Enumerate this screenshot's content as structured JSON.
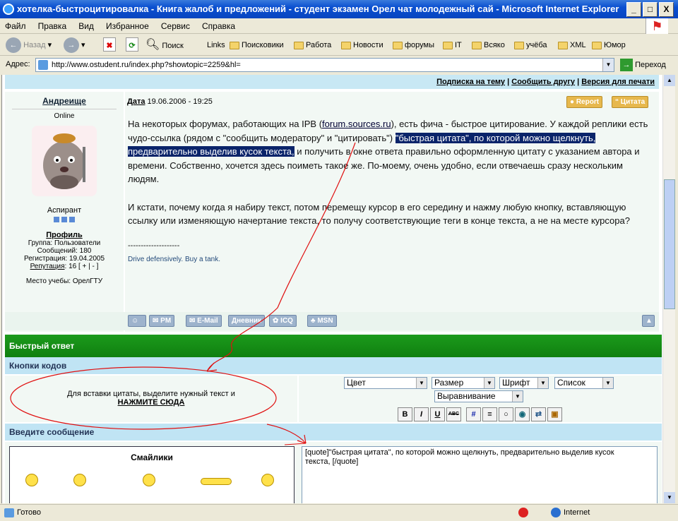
{
  "window": {
    "title": "хотелка-быстроцитировалка - Книга жалоб и предложений - студент экзамен Орел чат молодежный сай - Microsoft Internet Explorer",
    "minimize": "_",
    "maximize": "□",
    "close": "X"
  },
  "menu": [
    "Файл",
    "Правка",
    "Вид",
    "Избранное",
    "Сервис",
    "Справка"
  ],
  "toolbar": {
    "back": "Назад",
    "search": "Поиск",
    "links_label": "Links",
    "links": [
      "Поисковики",
      "Работа",
      "Новости",
      "форумы",
      "IT",
      "Всяко",
      "учёба",
      "XML",
      "Юмор"
    ]
  },
  "address": {
    "label": "Адрес:",
    "url": "http://www.ostudent.ru/index.php?showtopic=2259&hl=",
    "go": "Переход"
  },
  "topic_links": {
    "subscribe": "Подписка на тему",
    "send": "Сообщить другу",
    "print": "Версия для печати",
    "sep": "|"
  },
  "post": {
    "author": "Андреище",
    "status": "Online",
    "rank": "Аспирант",
    "profile": "Профиль",
    "group": "Группа: Пользователи",
    "messages": "Сообщений: 180",
    "registered": "Регистрация: 19.04.2005",
    "reputation_label": "Репутация",
    "reputation_value": "16 [ + | - ]",
    "study": "Место учебы: ОрелГТУ",
    "date_label": "Дата",
    "date_value": "19.06.2006 - 19:25",
    "report": "Report",
    "quote": "Цитата",
    "p1a": "На некоторых форумах, работающих на IPB (",
    "p1link": "forum.sources.ru",
    "p1b": "), есть фича - быстрое цитирование. У каждой реплики есть чудо-ссылка (рядом с \"сообщить модератору\" и \"цитировать\") ",
    "p1hl": "\"быстрая цитата\", по которой можно щелкнуть, предварительно выделив кусок текста,",
    "p1c": " и получить в окне ответа правильно оформленную цитату с указанием автора и времени. Собственно, хочется здесь поиметь такое же. По-моему, очень удобно, если отвечаешь сразу нескольким людям.",
    "p2": "И кстати, почему когда я набиру текст, потом перемещу курсор в его середину и нажму любую кнопку, вставляющую ссылку или изменяющую начертание текста, то получу соответствующие теги в конце текста, а не на месте курсора?",
    "sig_line": "--------------------",
    "signature": "Drive defensively. Buy a tank.",
    "buttons": {
      "pm": "PM",
      "email": "E-Mail",
      "diary": "Дневник",
      "icq": "ICQ",
      "msn": "MSN"
    }
  },
  "reply": {
    "header": "Быстрый ответ",
    "codes_header": "Кнопки кодов",
    "hint": "Для вставки цитаты, выделите нужный текст и",
    "hint_link": "НАЖМИТЕ СЮДА",
    "selects": {
      "color": "Цвет",
      "size": "Размер",
      "font": "Шрифт",
      "list": "Список",
      "align": "Выравнивание"
    },
    "format_buttons": [
      "B",
      "I",
      "U",
      "ABC",
      "#",
      "≡",
      "○",
      "◉",
      "⇄",
      "▣"
    ],
    "enter_header": "Введите сообщение",
    "smilies": "Смайлики",
    "textarea": "[quote]\"быстрая цитата\", по которой можно щелкнуть, предварительно выделив кусок текста, [/quote]"
  },
  "status": {
    "text": "Готово",
    "zone": "Internet"
  },
  "colors": {
    "annotation": "#e01010",
    "highlight": "#0a246a",
    "greenbar": "#1c9a1c"
  }
}
